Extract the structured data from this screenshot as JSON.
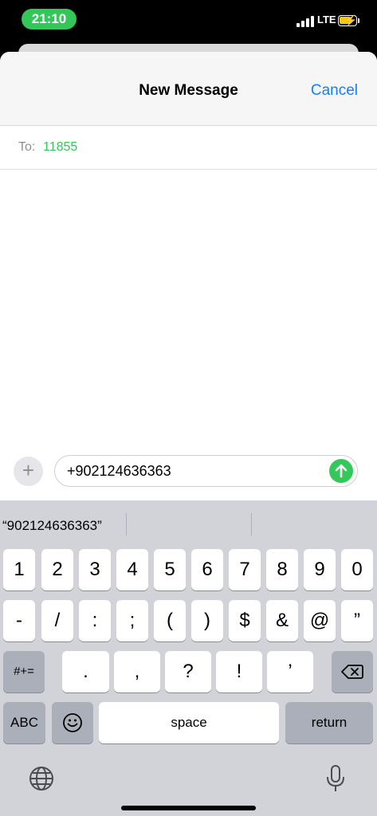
{
  "status_bar": {
    "time": "21:10",
    "network": "LTE",
    "time_pill_color": "#33c759"
  },
  "nav": {
    "title": "New Message",
    "cancel_label": "Cancel"
  },
  "recipient": {
    "to_label": "To:",
    "value": "11855"
  },
  "compose": {
    "text": "+902124636363",
    "plus_icon": "plus-icon",
    "send_icon": "send-arrow-icon"
  },
  "keyboard": {
    "suggestion": "“902124636363”",
    "rows": [
      [
        "1",
        "2",
        "3",
        "4",
        "5",
        "6",
        "7",
        "8",
        "9",
        "0"
      ],
      [
        "-",
        "/",
        ":",
        ";",
        "(",
        ")",
        "$",
        "&",
        "@",
        "”"
      ],
      [
        ".",
        ",",
        "?",
        "!",
        "’"
      ]
    ],
    "symbols_label": "#+=",
    "abc_label": "ABC",
    "space_label": "space",
    "return_label": "return",
    "icons": [
      "delete-icon",
      "emoji-icon",
      "globe-icon",
      "microphone-icon"
    ]
  },
  "colors": {
    "accent_blue": "#157efb",
    "accent_green": "#34c759",
    "keyboard_bg": "#d1d3d9"
  }
}
